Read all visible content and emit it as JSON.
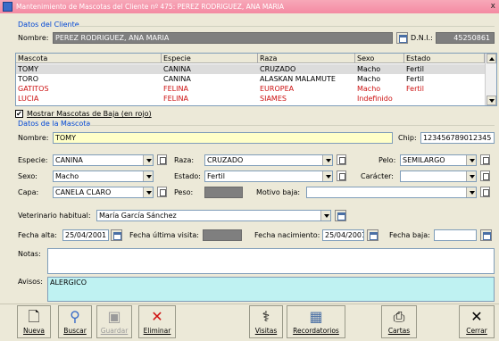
{
  "window": {
    "title": "Mantenimiento de Mascotas del Cliente nº 475: PEREZ RODRIGUEZ, ANA MARIA",
    "close": "x"
  },
  "client": {
    "group_title": "Datos del Cliente",
    "nombre_label": "Nombre:",
    "nombre_value": "PEREZ RODRIGUEZ, ANA MARIA",
    "dni_label": "D.N.I.:",
    "dni_value": "45250861"
  },
  "grid": {
    "columns": [
      "Mascota",
      "Especie",
      "Raza",
      "Sexo",
      "Estado"
    ],
    "rows": [
      {
        "mascota": "TOMY",
        "especie": "CANINA",
        "raza": "CRUZADO",
        "sexo": "Macho",
        "estado": "Fertil"
      },
      {
        "mascota": "TORO",
        "especie": "CANINA",
        "raza": "ALASKAN MALAMUTE",
        "sexo": "Macho",
        "estado": "Fertil"
      },
      {
        "mascota": "GATITOS",
        "especie": "FELINA",
        "raza": "EUROPEA",
        "sexo": "Macho",
        "estado": "Fertil"
      },
      {
        "mascota": "LUCIA",
        "especie": "FELINA",
        "raza": "SIAMES",
        "sexo": "Indefinido",
        "estado": ""
      }
    ]
  },
  "show_baja": {
    "checked_mark": "✔",
    "label": "Mostrar Mascotas de Baja (en rojo)"
  },
  "pet": {
    "group_title": "Datos de la Mascota",
    "nombre_label": "Nombre:",
    "nombre_value": "TOMY",
    "chip_label": "Chip:",
    "chip_value": "123456789012345",
    "especie_label": "Especie:",
    "especie_value": "CANINA",
    "raza_label": "Raza:",
    "raza_value": "CRUZADO",
    "pelo_label": "Pelo:",
    "pelo_value": "SEMILARGO",
    "sexo_label": "Sexo:",
    "sexo_value": "Macho",
    "estado_label": "Estado:",
    "estado_value": "Fertil",
    "caracter_label": "Carácter:",
    "caracter_value": "",
    "capa_label": "Capa:",
    "capa_value": "CANELA CLARO",
    "peso_label": "Peso:",
    "peso_value": "",
    "motivo_label": "Motivo baja:",
    "motivo_value": "",
    "vet_label": "Veterinario habitual:",
    "vet_value": "María García Sánchez",
    "fecha_alta_label": "Fecha alta:",
    "fecha_alta_value": "25/04/2001",
    "ultima_visita_label": "Fecha última visita:",
    "ultima_visita_value": "",
    "nacimiento_label": "Fecha nacimiento:",
    "nacimiento_value": "25/04/2001",
    "baja_label": "Fecha baja:",
    "baja_value": "",
    "notas_label": "Notas:",
    "notas_value": "",
    "avisos_label": "Avisos:",
    "avisos_value": "ALERGICO"
  },
  "toolbar": {
    "nueva": "Nueva",
    "buscar": "Buscar",
    "guardar": "Guardar",
    "eliminar": "Eliminar",
    "visitas": "Visitas",
    "recordatorios": "Recordatorios",
    "cartas": "Cartas",
    "cerrar": "Cerrar"
  },
  "colors": {
    "title_bar": "#f48aa3",
    "group_title": "#0046d5",
    "inactive_row": "#cc1111",
    "nombre_highlight": "#ffffc8",
    "avisos_highlight": "#bff2f2",
    "delete_icon": "#d01010"
  }
}
